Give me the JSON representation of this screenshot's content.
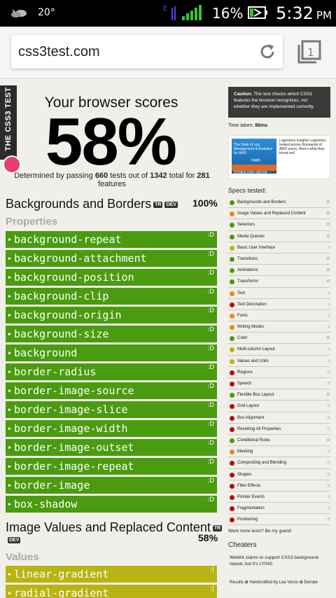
{
  "status_bar": {
    "temperature": "20°",
    "battery_percent": "16%",
    "time": "5:32",
    "ampm": "PM"
  },
  "browser": {
    "url": "css3test.com",
    "tab_count": "1"
  },
  "ribbon": {
    "label": "THE CSS3 TEST"
  },
  "score": {
    "heading": "Your browser scores",
    "percent": "58%",
    "info_prefix": "Determined by passing",
    "passed": "660",
    "info_mid": "tests out of",
    "total": "1342",
    "info_mid2": "total for",
    "features": "281",
    "info_suffix": "features"
  },
  "sections": [
    {
      "title": "Backgrounds and Borders",
      "tags": [
        "TR",
        "DEV"
      ],
      "percent": "100%",
      "sublabel": "Properties",
      "rows": [
        {
          "label": "background-repeat",
          "face": ":D",
          "status": "pass"
        },
        {
          "label": "background-attachment",
          "face": ":D",
          "status": "pass"
        },
        {
          "label": "background-position",
          "face": ":D",
          "status": "pass"
        },
        {
          "label": "background-clip",
          "face": ":D",
          "status": "pass"
        },
        {
          "label": "background-origin",
          "face": ":D",
          "status": "pass"
        },
        {
          "label": "background-size",
          "face": ":D",
          "status": "pass"
        },
        {
          "label": "background",
          "face": ":D",
          "status": "pass"
        },
        {
          "label": "border-radius",
          "face": ":D",
          "status": "pass"
        },
        {
          "label": "border-image-source",
          "face": ":D",
          "status": "pass"
        },
        {
          "label": "border-image-slice",
          "face": ":D",
          "status": "pass"
        },
        {
          "label": "border-image-width",
          "face": ":D",
          "status": "pass"
        },
        {
          "label": "border-image-outset",
          "face": ":D",
          "status": "pass"
        },
        {
          "label": "border-image-repeat",
          "face": ":D",
          "status": "pass"
        },
        {
          "label": "border-image",
          "face": ":D",
          "status": "pass"
        },
        {
          "label": "box-shadow",
          "face": ":D",
          "status": "pass"
        }
      ]
    },
    {
      "title": "Image Values and Replaced Content",
      "tags": [
        "TR",
        "DEV"
      ],
      "percent": "58%",
      "sublabel": "Values",
      "rows": [
        {
          "label": "linear-gradient",
          "face": ":|",
          "status": "partial"
        },
        {
          "label": "radial-gradient",
          "face": ":|",
          "status": "partial"
        }
      ]
    }
  ],
  "sidebar": {
    "caution_label": "Caution:",
    "caution_text": "This test checks which CSS3 features the browser recognizes,",
    "caution_em": "not",
    "caution_tail": "whether they are implemented correctly.",
    "time_label": "Time taken:",
    "time_value": "86ms",
    "ad_headline": "The State of Log Management & Analytics for AWS",
    "ad_brand": "loggly",
    "ad_cta": "DOWNLOAD eBOOK",
    "ad_text": "Logentries Insights Logentries looked across thousands of AWS users. Here's what they found out!",
    "specs_title": "Specs tested:",
    "specs": [
      {
        "name": "Backgrounds and Borders",
        "color": "#4a9b0f",
        "face": ":D"
      },
      {
        "name": "Image Values and Replaced Content",
        "color": "#e8891a",
        "face": ":D"
      },
      {
        "name": "Selectors",
        "color": "#4a9b0f",
        "face": ":D"
      },
      {
        "name": "Media Queries",
        "color": "#4a9b0f",
        "face": ":D"
      },
      {
        "name": "Basic User Interface",
        "color": "#b8b413",
        "face": ":|"
      },
      {
        "name": "Transitions",
        "color": "#4a9b0f",
        "face": ":D"
      },
      {
        "name": "Animations",
        "color": "#4a9b0f",
        "face": ":D"
      },
      {
        "name": "Transforms",
        "color": "#4a9b0f",
        "face": ":D"
      },
      {
        "name": "Text",
        "color": "#e8891a",
        "face": ":("
      },
      {
        "name": "Text Decoration",
        "color": "#b00f0f",
        "face": ":("
      },
      {
        "name": "Fonts",
        "color": "#e8891a",
        "face": ":("
      },
      {
        "name": "Writing Modes",
        "color": "#e8891a",
        "face": ":("
      },
      {
        "name": "Color",
        "color": "#4a9b0f",
        "face": ":D"
      },
      {
        "name": "Multi-column Layout",
        "color": "#b8b413",
        "face": ":|"
      },
      {
        "name": "Values and Units",
        "color": "#b8b413",
        "face": ":|"
      },
      {
        "name": "Regions",
        "color": "#b00f0f",
        "face": ":'("
      },
      {
        "name": "Speech",
        "color": "#b00f0f",
        "face": ":'("
      },
      {
        "name": "Flexible Box Layout",
        "color": "#4a9b0f",
        "face": ":D"
      },
      {
        "name": "Grid Layout",
        "color": "#b00f0f",
        "face": ":'("
      },
      {
        "name": "Box Alignment",
        "color": "#b00f0f",
        "face": ":'("
      },
      {
        "name": "Resetting All Properties",
        "color": "#b00f0f",
        "face": ":'("
      },
      {
        "name": "Conditional Rules",
        "color": "#4a9b0f",
        "face": ":D"
      },
      {
        "name": "Masking",
        "color": "#e8891a",
        "face": ":("
      },
      {
        "name": "Compositing and Blending",
        "color": "#b00f0f",
        "face": ":'("
      },
      {
        "name": "Shapes",
        "color": "#b00f0f",
        "face": ":'("
      },
      {
        "name": "Filter Effects",
        "color": "#b00f0f",
        "face": ":'("
      },
      {
        "name": "Pointer Events",
        "color": "#b00f0f",
        "face": ":'("
      },
      {
        "name": "Fragmentation",
        "color": "#b00f0f",
        "face": ":("
      },
      {
        "name": "Positioning",
        "color": "#b00f0f",
        "face": ":'("
      }
    ],
    "guest_prefix": "Want more tests?",
    "guest_link": "Be my guest!",
    "cheaters_title": "Cheaters",
    "cheaters_text": "WebKit claims to support CSS3 background-repeat, but it's LYING",
    "footer": "Results ✿ Handcrafted by Lea Verou ✿ Donate"
  }
}
